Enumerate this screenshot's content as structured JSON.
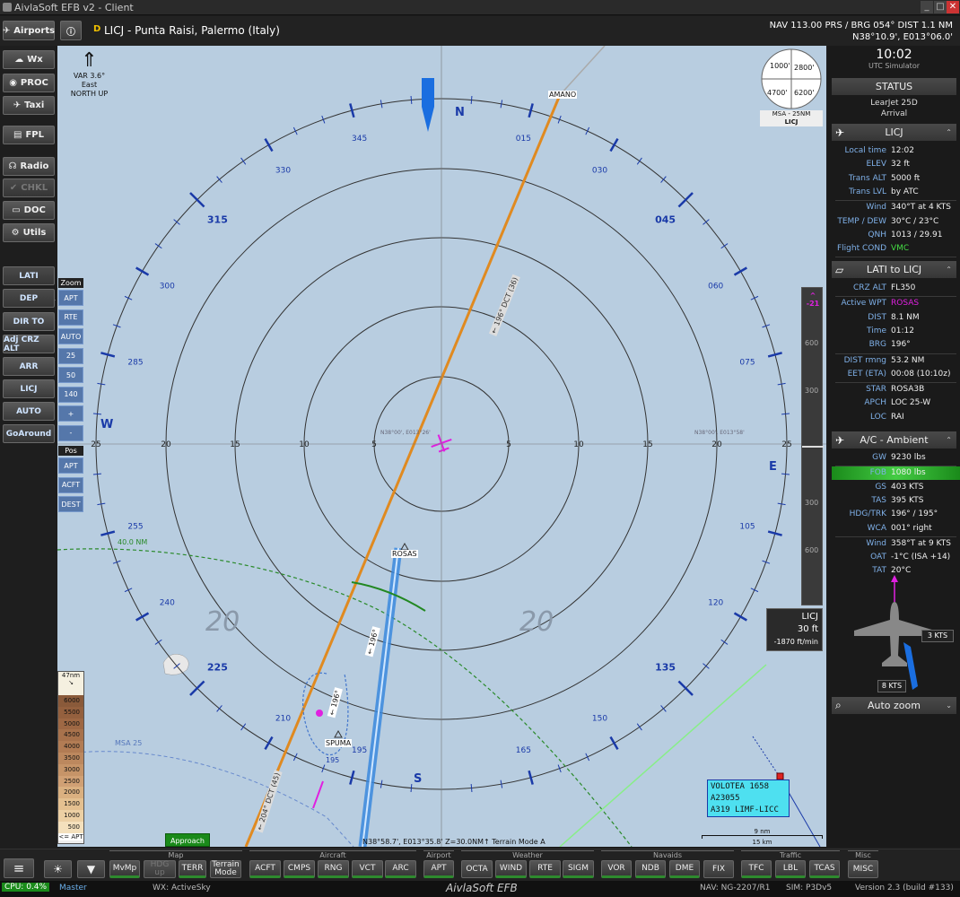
{
  "window": {
    "title": "AivlaSoft EFB v2 - Client",
    "min": "_",
    "max": "□",
    "close": "✕"
  },
  "top": {
    "airports_btn": "Airports",
    "info_btn": "ⓘ",
    "airport_badge": "D",
    "airport_title": "LICJ - Punta Raisi, Palermo (Italy)",
    "nav_line1": "NAV 113.00 PRS / BRG 054°  DIST 1.1 NM",
    "nav_line2": "N38°10.9', E013°06.0'"
  },
  "left_buttons": [
    {
      "label": "Wx",
      "icon": "cloud-icon",
      "glyph": "☁",
      "enabled": true
    },
    {
      "label": "PROC",
      "icon": "procedure-icon",
      "glyph": "◉",
      "enabled": true
    },
    {
      "label": "Taxi",
      "icon": "taxi-icon",
      "glyph": "✈",
      "enabled": true
    },
    {
      "label": "FPL",
      "icon": "flightplan-icon",
      "glyph": "▤",
      "enabled": true
    },
    {
      "label": "Radio",
      "icon": "headset-icon",
      "glyph": "☊",
      "enabled": true
    },
    {
      "label": "CHKL",
      "icon": "checklist-icon",
      "glyph": "✔",
      "enabled": false
    },
    {
      "label": "DOC",
      "icon": "document-icon",
      "glyph": "▭",
      "enabled": true
    },
    {
      "label": "Utils",
      "icon": "utils-icon",
      "glyph": "⚙",
      "enabled": true
    }
  ],
  "rsb": {
    "label": "RSB",
    "buttons": [
      {
        "label": "LATI",
        "enabled": false
      },
      {
        "label": "DEP",
        "enabled": false
      },
      {
        "label": "DIR TO",
        "enabled": true
      },
      {
        "label": "Adj CRZ ALT",
        "enabled": true
      },
      {
        "label": "ARR",
        "enabled": true
      },
      {
        "label": "LICJ",
        "enabled": true
      },
      {
        "label": "AUTO",
        "enabled": true
      },
      {
        "label": "GoAround",
        "enabled": false
      }
    ]
  },
  "zoom": {
    "header": "Zoom",
    "buttons": [
      "APT",
      "RTE",
      "AUTO",
      "25",
      "50",
      "140",
      "+",
      "-"
    ],
    "pos_header": "Pos",
    "pos_buttons": [
      "APT",
      "ACFT",
      "DEST"
    ]
  },
  "map": {
    "var_line1": "VAR 3.6° East",
    "var_line2": "NORTH UP",
    "cardinals": {
      "n": "N",
      "e": "E",
      "s": "S",
      "w": "W"
    },
    "compass_labels": [
      {
        "t": "345",
        "b": false,
        "deg": 345
      },
      {
        "t": "015",
        "b": false,
        "deg": 15
      },
      {
        "t": "030",
        "b": false,
        "deg": 30
      },
      {
        "t": "045",
        "b": true,
        "deg": 45
      },
      {
        "t": "060",
        "b": false,
        "deg": 60
      },
      {
        "t": "075",
        "b": false,
        "deg": 75
      },
      {
        "t": "105",
        "b": false,
        "deg": 105
      },
      {
        "t": "120",
        "b": false,
        "deg": 120
      },
      {
        "t": "135",
        "b": true,
        "deg": 135
      },
      {
        "t": "150",
        "b": false,
        "deg": 150
      },
      {
        "t": "165",
        "b": false,
        "deg": 165
      },
      {
        "t": "195",
        "b": false,
        "deg": 195
      },
      {
        "t": "210",
        "b": false,
        "deg": 210
      },
      {
        "t": "225",
        "b": true,
        "deg": 225
      },
      {
        "t": "240",
        "b": false,
        "deg": 240
      },
      {
        "t": "255",
        "b": false,
        "deg": 255
      },
      {
        "t": "285",
        "b": false,
        "deg": 285
      },
      {
        "t": "300",
        "b": false,
        "deg": 300
      },
      {
        "t": "315",
        "b": true,
        "deg": 315
      },
      {
        "t": "330",
        "b": false,
        "deg": 330
      }
    ],
    "range_left": [
      "25",
      "20",
      "15",
      "10",
      "5"
    ],
    "range_right": [
      "5",
      "10",
      "15",
      "20",
      "25"
    ],
    "waypoints": {
      "amano": "AMANO",
      "rosas": "ROSAS",
      "spuma": "SPUMA"
    },
    "leg_top": [
      "← 196°",
      "DCT",
      "(36)"
    ],
    "leg_bottom": [
      "← 204°",
      "DCT",
      "(45)"
    ],
    "leg_mid": "← 196°",
    "leg_approach": "← 196°",
    "leg_near": "195",
    "arc_40nm": "40.0 NM",
    "msa_arc": "MSA 25",
    "big20_left": "20",
    "big20_right": "20",
    "center_coords_l": "N38°00', E013°26'",
    "center_coords_r": "N38°00', E013°58'",
    "bottom_coords": "N38°58.7', E013°35.8'  Z=30.0NM↑  Terrain Mode A",
    "approach_tab": "Approach",
    "scale_nm": "9 nm",
    "scale_km": "15 km",
    "msa_box": {
      "q_nw": "1000'",
      "q_ne": "2800'",
      "q_sw": "4700'",
      "q_se": "6200'",
      "label": "MSA - 25NM",
      "apt": "LICJ"
    },
    "vsi": {
      "top": "-21",
      "t600": "600",
      "t300": "300",
      "b300": "300",
      "b600": "600"
    },
    "dest_box": {
      "apt": "LICJ",
      "alt": "30 ft",
      "vs": "-1870 ft/min"
    },
    "traffic": {
      "line1": "VOLOTEA 1658",
      "line2": "A23055",
      "line3": "A319 LIMF-LICC"
    },
    "terrain_legend": {
      "top": "47nm",
      "levels": [
        "6000",
        "5500",
        "5000",
        "4500",
        "4000",
        "3500",
        "3000",
        "2500",
        "2000",
        "1500",
        "1000",
        "500"
      ],
      "bottom": "<= APT"
    }
  },
  "right": {
    "time": "10:02",
    "time_sub": "UTC Simulator",
    "status_btn": "STATUS",
    "aircraft": "LearJet 25D",
    "phase": "Arrival",
    "licj": {
      "header": "LICJ",
      "rows": [
        {
          "k": "Local time",
          "v": "12:02"
        },
        {
          "k": "ELEV",
          "v": "32 ft"
        },
        {
          "k": "Trans ALT",
          "v": "5000 ft"
        },
        {
          "k": "Trans LVL",
          "v": "by ATC"
        },
        {
          "k": "Wind",
          "v": "340°T at 4 KTS"
        },
        {
          "k": "TEMP / DEW",
          "v": "30°C  /  23°C"
        },
        {
          "k": "QNH",
          "v": "1013 / 29.91"
        },
        {
          "k": "Flight COND",
          "v": "VMC"
        }
      ]
    },
    "route": {
      "header": "LATI to LICJ",
      "rows": [
        {
          "k": "CRZ ALT",
          "v": "FL350"
        },
        {
          "k": "Active WPT",
          "v": "ROSAS"
        },
        {
          "k": "DIST",
          "v": "8.1 NM"
        },
        {
          "k": "Time",
          "v": "01:12"
        },
        {
          "k": "BRG",
          "v": "196°"
        },
        {
          "k": "DIST rmng",
          "v": "53.2 NM"
        },
        {
          "k": "EET (ETA)",
          "v": "00:08 (10:10z)"
        },
        {
          "k": "STAR",
          "v": "ROSA3B"
        },
        {
          "k": "APCH",
          "v": "LOC 25-W"
        },
        {
          "k": "LOC",
          "v": "RAI"
        }
      ]
    },
    "ambient": {
      "header": "A/C - Ambient",
      "rows": [
        {
          "k": "GW",
          "v": "9230 lbs"
        },
        {
          "k": "FOB",
          "v": "1080 lbs"
        },
        {
          "k": "GS",
          "v": "403 KTS"
        },
        {
          "k": "TAS",
          "v": "395 KTS"
        },
        {
          "k": "HDG/TRK",
          "v": "196° / 195°"
        },
        {
          "k": "WCA",
          "v": "001° right"
        },
        {
          "k": "Wind",
          "v": "358°T at 9 KTS"
        },
        {
          "k": "OAT",
          "v": "-1°C  (ISA +14)"
        },
        {
          "k": "TAT",
          "v": "20°C"
        }
      ],
      "wind_kts": "3 KTS",
      "wind_kts2": "8 KTS"
    },
    "autozoom": "Auto zoom"
  },
  "bottom": {
    "groups": {
      "map": "Map",
      "aircraft": "Aircraft",
      "airport": "Airport",
      "weather": "Weather",
      "navaids": "Navaids",
      "traffic": "Traffic",
      "misc": "Misc"
    },
    "buttons": {
      "mvmp": "MvMp",
      "hdgup": "HDG up",
      "terr": "TERR",
      "terrmode": "Terrain Mode",
      "acft": "ACFT",
      "cmps": "CMPS",
      "rng": "RNG",
      "vct": "VCT",
      "arc": "ARC",
      "apt": "APT",
      "octa": "OCTA",
      "wind": "WIND",
      "rte": "RTE",
      "sigm": "SIGM",
      "vor": "VOR",
      "ndb": "NDB",
      "dme": "DME",
      "fix": "FIX",
      "tfc": "TFC",
      "lbl": "LBL",
      "tcas": "TCAS",
      "misc": "MISC"
    }
  },
  "status": {
    "cpu": "CPU: 0.4%",
    "master": "Master",
    "wx": "WX: ActiveSky",
    "brand": "AivlaSoft EFB",
    "nav": "NAV: NG-2207/R1",
    "sim": "SIM: P3Dv5",
    "version": "Version 2.3 (build #133)"
  },
  "colors": {
    "accent_blue": "#1a3aa8",
    "route_orange": "#e08a20",
    "magenta": "#e020e0",
    "vmc_green": "#44dd44",
    "map_bg": "#b8cde0"
  }
}
